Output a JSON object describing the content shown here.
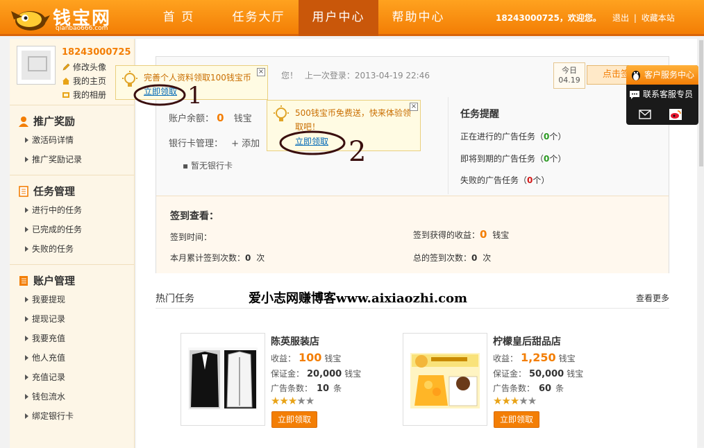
{
  "header": {
    "logo_text": "钱宝网",
    "logo_sub": "qianbao666.com",
    "nav": [
      "首 页",
      "任务大厅",
      "用户中心",
      "帮助中心"
    ],
    "active_nav": "用户中心",
    "user_welcome": "18243000725，欢迎您。",
    "logout": "退出",
    "favorite": "收藏本站",
    "sep": "|"
  },
  "sidebar": {
    "username": "18243000725",
    "profile_links": [
      "修改头像",
      "我的主页",
      "我的相册"
    ],
    "sections": [
      {
        "title": "推广奖励",
        "items": [
          "激活码详情",
          "推广奖励记录"
        ]
      },
      {
        "title": "任务管理",
        "items": [
          "进行中的任务",
          "已完成的任务",
          "失败的任务"
        ]
      },
      {
        "title": "账户管理",
        "items": [
          "我要提现",
          "提现记录",
          "我要充值",
          "他人充值",
          "充值记录",
          "钱包流水",
          "绑定银行卡"
        ]
      }
    ]
  },
  "account": {
    "last_login_prefix": "您！",
    "last_login": "上一次登录：2013-04-19 22:46",
    "date_top": "今日",
    "date_bottom": "04.19",
    "sign_button": "点击签到",
    "balance_label": "账户余额：",
    "balance_value": "0",
    "balance_unit": "钱宝",
    "bank_label": "银行卡管理：",
    "bank_add": "+ 添加",
    "no_bank": "暂无银行卡"
  },
  "tasks": {
    "title": "任务提醒",
    "lines": [
      {
        "label": "正在进行的广告任务",
        "value": "0",
        "color": "green"
      },
      {
        "label": "即将到期的广告任务",
        "value": "0",
        "color": "green"
      },
      {
        "label": "失败的广告任务",
        "value": "0",
        "color": "red"
      }
    ],
    "paren_open": "（",
    "paren_close": "个）"
  },
  "signin": {
    "title": "签到查看：",
    "time_label": "签到时间：",
    "month_label": "本月累计签到次数：",
    "month_value": "0",
    "times_unit": "次",
    "earn_label": "签到获得的收益：",
    "earn_value": "0",
    "earn_unit": "钱宝",
    "total_label": "总的签到次数：",
    "total_value": "0"
  },
  "hot": {
    "title": "热门任务",
    "watermark": "爱小志网赚博客www.aixiaozhi.com",
    "more": "查看更多",
    "cards": [
      {
        "name": "陈英服装店",
        "income_label": "收益：",
        "income": "100",
        "deposit_label": "保证金：",
        "deposit": "20,000",
        "count_label": "广告条数：",
        "count": "10",
        "count_unit": "条",
        "unit": "钱宝",
        "rating": 3,
        "max_rating": 5,
        "button": "立即领取"
      },
      {
        "name": "柠檬皇后甜品店",
        "income_label": "收益：",
        "income": "1,250",
        "deposit_label": "保证金：",
        "deposit": "50,000",
        "count_label": "广告条数：",
        "count": "60",
        "count_unit": "条",
        "unit": "钱宝",
        "rating": 3,
        "max_rating": 5,
        "button": "立即领取"
      }
    ]
  },
  "tips": [
    {
      "text": "完善个人资料领取100钱宝币",
      "link": "立即领取"
    },
    {
      "text": "500钱宝币免费送，快来体验领取吧！",
      "link": "立即领取"
    }
  ],
  "service": {
    "title": "客户服务中心",
    "contact": "联系客服专员"
  },
  "annotations": [
    "1",
    "2"
  ],
  "colors": {
    "accent": "#f37e05",
    "header_active": "#c9570a",
    "green": "#2a9a21",
    "red": "#d41919",
    "link": "#0068b7"
  }
}
